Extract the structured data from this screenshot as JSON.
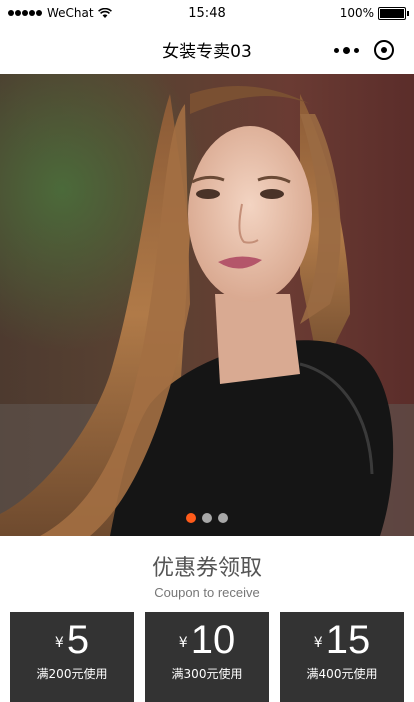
{
  "status": {
    "carrier": "WeChat",
    "time": "15:48",
    "battery": "100%"
  },
  "nav": {
    "title": "女装专卖03"
  },
  "banner": {
    "dots": [
      {
        "active": true,
        "color": "#ff5b1a"
      },
      {
        "active": false,
        "color": "#a8a8a8"
      },
      {
        "active": false,
        "color": "#a8a8a8"
      }
    ]
  },
  "coupon_section": {
    "title": "优惠券领取",
    "subtitle": "Coupon to receive",
    "currency": "¥",
    "coupons": [
      {
        "amount": "5",
        "condition": "满200元使用"
      },
      {
        "amount": "10",
        "condition": "满300元使用"
      },
      {
        "amount": "15",
        "condition": "满400元使用"
      }
    ]
  },
  "colors": {
    "coupon_bg": "#333333",
    "dot_active": "#ff5b1a",
    "dot_inactive": "#a8a8a8"
  }
}
